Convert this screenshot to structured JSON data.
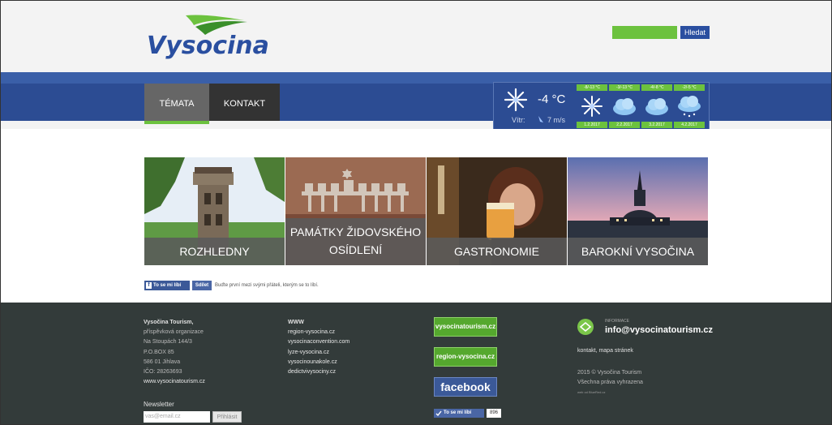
{
  "header": {
    "logo_text": "Vysocina",
    "search_placeholder": "",
    "search_button": "Hledat"
  },
  "nav": {
    "tabs": [
      {
        "label": "TÉMATA",
        "active": true
      },
      {
        "label": "KONTAKT",
        "active": false
      }
    ]
  },
  "weather": {
    "current_temp": "-4 °C",
    "wind_label": "Vítr:",
    "wind_value": "7 m/s",
    "current_icon": "snowflake-icon",
    "days": [
      {
        "range": "-8/-13 °C",
        "date": "1.2.2017",
        "icon": "snowflake-icon"
      },
      {
        "range": "-3/-13 °C",
        "date": "2.2.2017",
        "icon": "cloud-icon"
      },
      {
        "range": "-4/-8 °C",
        "date": "3.2.2017",
        "icon": "cloud-icon"
      },
      {
        "range": "-2/-5 °C",
        "date": "4.2.2017",
        "icon": "cloud-snow-icon"
      }
    ]
  },
  "tiles": [
    {
      "label": "ROZHLEDNY"
    },
    {
      "label_line1": "PAMÁTKY ŽIDOVSKÉHO",
      "label_line2": "OSÍDLENÍ"
    },
    {
      "label": "GASTRONOMIE"
    },
    {
      "label": "BAROKNÍ VYSOČINA"
    }
  ],
  "facebook_bar": {
    "like": "To se mi líbí",
    "share": "Sdílet",
    "text": "Buďte první mezi svými přáteli, kterým se to líbí."
  },
  "footer": {
    "address": {
      "title": "Vysočina Tourism,",
      "lines": [
        "příspěvková organizace",
        "Na Stoupách 144/3",
        "P.O.BOX 85",
        "586 01 Jihlava",
        "IČO: 28263693"
      ],
      "web": "www.vysocinatourism.cz"
    },
    "www": {
      "title": "WWW",
      "links": [
        "region-vysocina.cz",
        "vysocinaconvention.com",
        "lyze-vysocina.cz",
        "vysocinounakole.cz",
        "dedictvivysociny.cz"
      ]
    },
    "badges": {
      "b1": "vysocinatourism.cz",
      "b2": "region-vysocina.cz",
      "facebook": "facebook",
      "like": "To se mi líbí",
      "like_count": "896"
    },
    "info": {
      "small": "INFORMACE",
      "email": "info@vysocinatourism.cz",
      "links": "kontakt, mapa stránek",
      "copy1": "2015 © Vysočina Tourism",
      "copy2": "Všechna práva vyhrazena",
      "web_by": "web od BlueRed.cz"
    },
    "newsletter": {
      "title": "Newsletter",
      "placeholder": "vas@email.cz",
      "button": "Přihlásit"
    }
  }
}
